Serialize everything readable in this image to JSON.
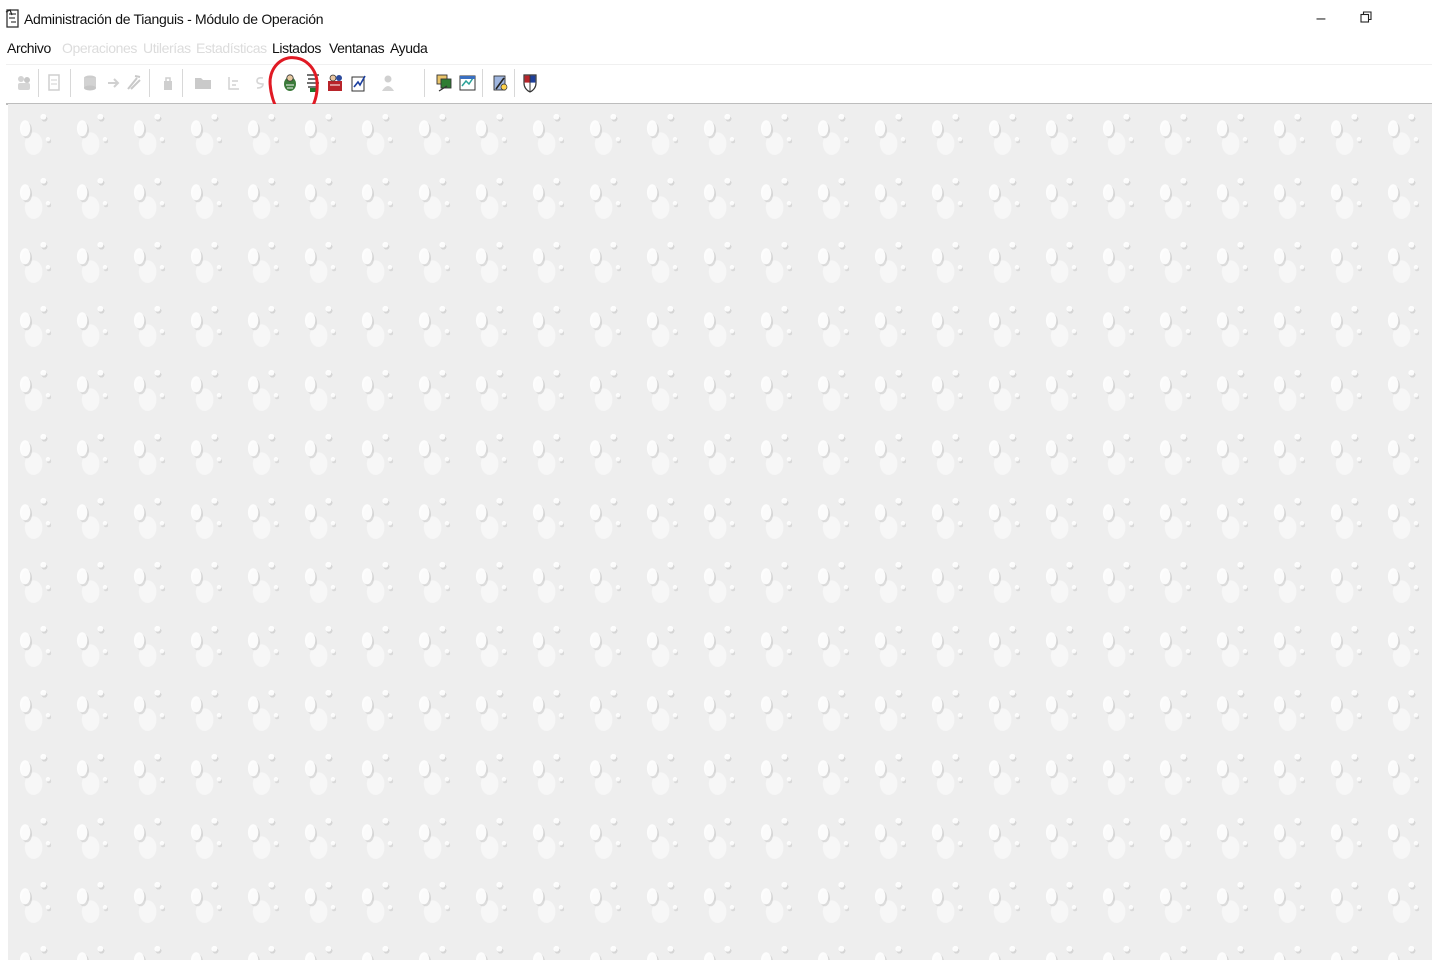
{
  "window": {
    "title": "Administración de Tianguis - Módulo de Operación",
    "minimize_glyph": "–",
    "restore_glyph": "🗗"
  },
  "menu": [
    {
      "label": "Archivo",
      "enabled": true
    },
    {
      "label": "Operaciones",
      "enabled": false
    },
    {
      "label": "Utilerías",
      "enabled": false
    },
    {
      "label": "Estadísticas",
      "enabled": false
    },
    {
      "label": "Listados",
      "enabled": true
    },
    {
      "label": "Ventanas",
      "enabled": true
    },
    {
      "label": "Ayuda",
      "enabled": true
    }
  ],
  "toolbar": {
    "buttons": [
      {
        "icon": "users-icon",
        "enabled": false
      },
      {
        "icon": "document-icon",
        "enabled": false
      },
      {
        "icon": "database-icon",
        "enabled": false
      },
      {
        "icon": "arrow-icon",
        "enabled": false
      },
      {
        "icon": "tools-icon",
        "enabled": false
      },
      {
        "icon": "lock-icon",
        "enabled": false
      },
      {
        "icon": "folder-icon",
        "enabled": false
      },
      {
        "icon": "report-icon",
        "enabled": false
      },
      {
        "icon": "money-icon",
        "enabled": false
      },
      {
        "icon": "merchant-list-icon",
        "enabled": true,
        "highlighted": true
      },
      {
        "icon": "stalls-list-icon",
        "enabled": true
      },
      {
        "icon": "vendors-report-icon",
        "enabled": true
      },
      {
        "icon": "chart-report-icon",
        "enabled": true
      },
      {
        "icon": "person-icon",
        "enabled": false
      },
      {
        "icon": "cascade-windows-icon",
        "enabled": true
      },
      {
        "icon": "tile-windows-icon",
        "enabled": true
      },
      {
        "icon": "help-icon",
        "enabled": true
      },
      {
        "icon": "about-shield-icon",
        "enabled": true
      }
    ]
  },
  "colors": {
    "highlight": "#e01a24",
    "background_pattern": "#eeeeee"
  }
}
